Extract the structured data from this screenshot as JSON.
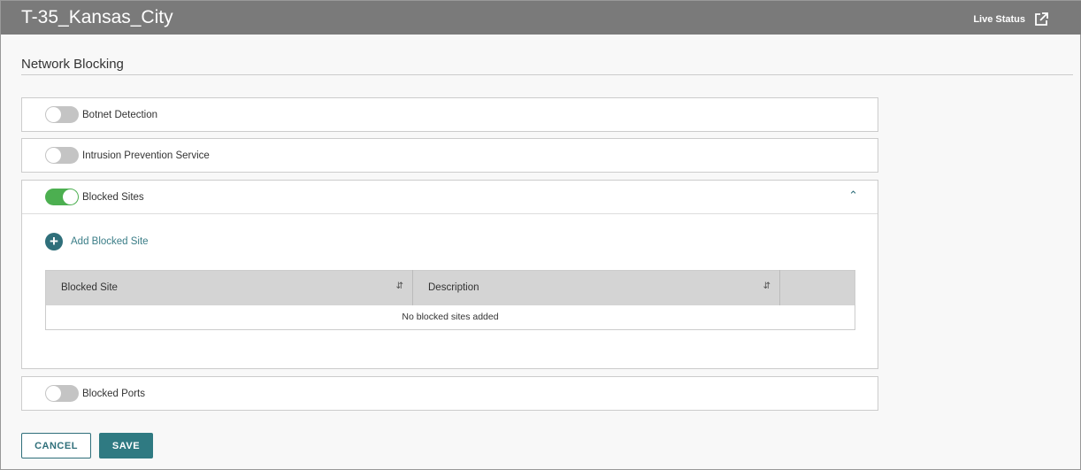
{
  "header": {
    "title": "T-35_Kansas_City",
    "live_status": "Live Status"
  },
  "section_title": "Network Blocking",
  "panels": [
    {
      "label": "Botnet Detection",
      "enabled": false
    },
    {
      "label": "Intrusion Prevention Service",
      "enabled": false
    },
    {
      "label": "Blocked Sites",
      "enabled": true
    },
    {
      "label": "Blocked Ports",
      "enabled": false
    }
  ],
  "blocked_sites": {
    "add_label": "Add Blocked Site",
    "columns": [
      "Blocked Site",
      "Description"
    ],
    "empty": "No blocked sites added"
  },
  "buttons": {
    "cancel": "CANCEL",
    "save": "SAVE"
  }
}
